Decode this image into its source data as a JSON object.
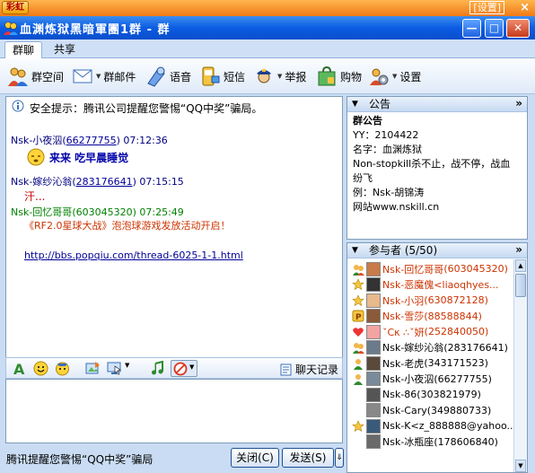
{
  "topstrip": {
    "badge": "彩虹",
    "settings": "[设置]",
    "close": "×"
  },
  "window": {
    "title": "血渊炼狱黑暗軍團1群 - 群",
    "min": "—",
    "max": "□",
    "close": "✕"
  },
  "tabs": [
    {
      "label": "群聊"
    },
    {
      "label": "共享"
    }
  ],
  "toolbar": [
    {
      "label": "群空间",
      "icon": "people-icon"
    },
    {
      "label": "群邮件",
      "icon": "mail-icon"
    },
    {
      "label": "语音",
      "icon": "voice-icon"
    },
    {
      "label": "短信",
      "icon": "sms-icon"
    },
    {
      "label": "举报",
      "icon": "police-icon"
    },
    {
      "label": "购物",
      "icon": "shopping-bag-icon"
    },
    {
      "label": "设置",
      "icon": "settings-icon"
    }
  ],
  "chat": {
    "security_notice": "安全提示：腾讯公司提醒您警惕“QQ中奖”骗局。",
    "messages": [
      {
        "sender": "Nsk-小夜泅",
        "qq": "66277755",
        "time": "07:12:36",
        "content": "来来  吃早晨睡觉"
      },
      {
        "sender": "Nsk-嫁纱沁翁",
        "qq": "283176641",
        "time": "07:15:15",
        "content": "汗..."
      },
      {
        "sender": "Nsk-回忆哥哥",
        "qq": "(603045320)",
        "time": "07:25:49",
        "content": "《RF2.0星球大战》泡泡球游戏发放活动开启！"
      }
    ],
    "link": "http://bbs.popqiu.com/thread-6025-1-1.html"
  },
  "input_toolbar": {
    "history_label": "聊天记录"
  },
  "bottom": {
    "tip": "腾讯提醒您警惕“QQ中奖”骗局",
    "close_btn": "关闭(C)",
    "send_btn": "发送(S)",
    "send_arrow": "⇓"
  },
  "announcement": {
    "header": "公告",
    "collapse": "»",
    "heading": "群公告",
    "lines": [
      "YY：2104422",
      "名字：血渊炼狱",
      "Non-stopkill杀不止，战不停，战血",
      "纷飞",
      "例：Nsk-胡锦涛",
      "网站www.nskill.cn"
    ]
  },
  "members_panel": {
    "header": "参与者 (5/50)",
    "collapse": "»",
    "members": [
      {
        "name": "Nsk-回忆哥哥",
        "qq": "(603045320)",
        "color": "#cc3300"
      },
      {
        "name": "Nsk-恶魔傀<liaoqhyes...",
        "qq": "",
        "color": "#cc3300"
      },
      {
        "name": "Nsk-小羽",
        "qq": "(630872128)",
        "color": "#cc3300"
      },
      {
        "name": "Nsk-雪莎",
        "qq": "(88588844)",
        "color": "#cc3300"
      },
      {
        "name": "ˇСκ ∴ˇ妍",
        "qq": "(252840050)",
        "color": "#cc3300"
      },
      {
        "name": "Nsk-嫁纱沁翁",
        "qq": "(283176641)",
        "color": "#000000"
      },
      {
        "name": "Nsk-老虎",
        "qq": "(343171523)",
        "color": "#000000"
      },
      {
        "name": "Nsk-小夜泅",
        "qq": "(66277755)",
        "color": "#000000"
      },
      {
        "name": "Nsk-86",
        "qq": "(303821979)",
        "color": "#000000"
      },
      {
        "name": "Nsk-Cary",
        "qq": "(349880733)",
        "color": "#000000"
      },
      {
        "name": "Nsk-K<z_888888@yahoo...",
        "qq": "",
        "color": "#000000"
      },
      {
        "name": "Nsk-冰瓶座",
        "qq": "(178606840)",
        "color": "#000000"
      }
    ]
  },
  "colors": {
    "title_bar": "#0b5ce2",
    "top_strip": "#f07a16",
    "frame": "#c9dcf3",
    "owner_name": "#cc3300"
  }
}
